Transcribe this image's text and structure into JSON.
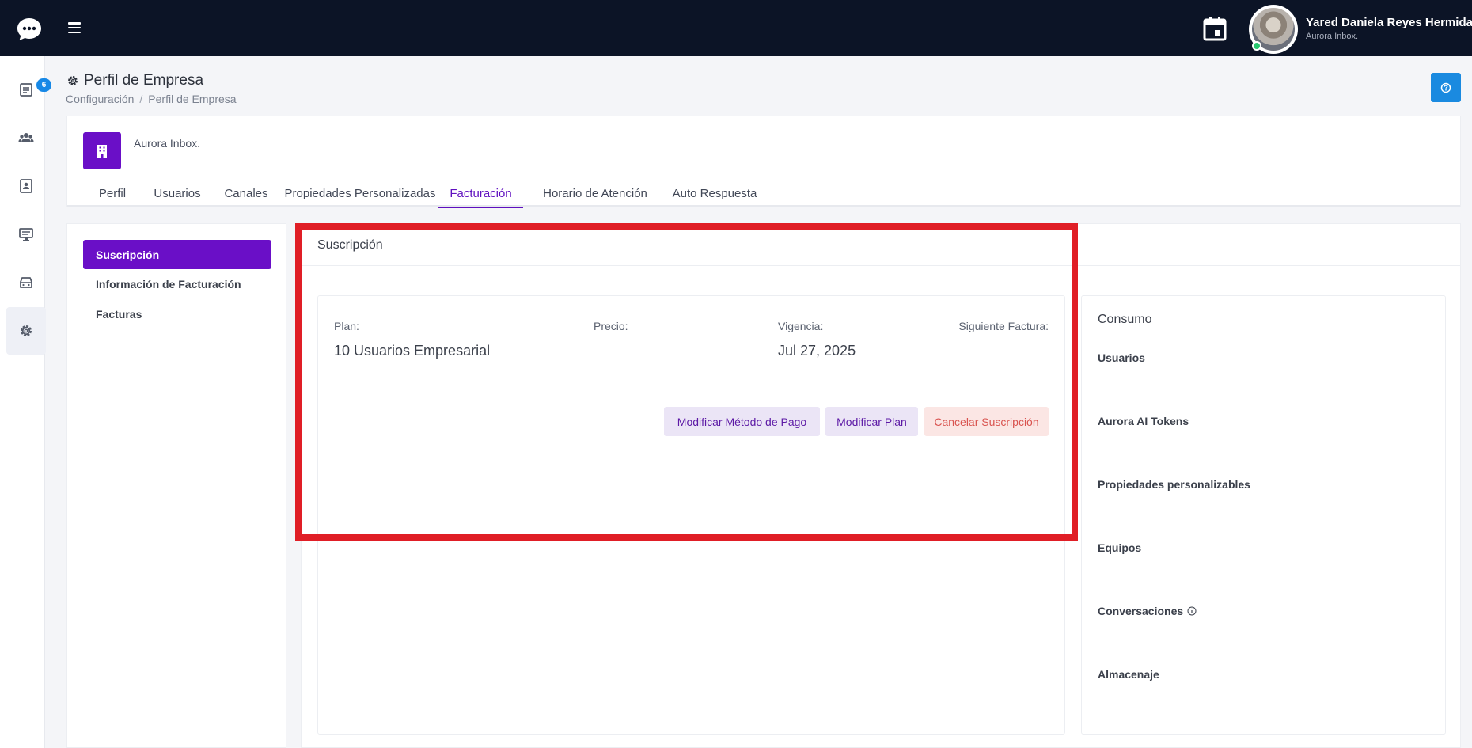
{
  "topbar": {
    "logo_icon": "chat-bubble-icon",
    "menu_icon": "hamburger-menu-icon",
    "calendar_icon": "calendar-icon",
    "user": {
      "name": "Yared Daniela Reyes Hermida",
      "organization": "Aurora Inbox.",
      "status": "online"
    }
  },
  "sidebar": {
    "items": [
      {
        "icon": "inbox-icon",
        "badge": "6"
      },
      {
        "icon": "team-icon"
      },
      {
        "icon": "contacts-icon"
      },
      {
        "icon": "monitor-icon"
      },
      {
        "icon": "tray-icon"
      },
      {
        "icon": "settings-icon",
        "active": true
      }
    ]
  },
  "header": {
    "title": "Perfil de Empresa",
    "title_icon": "gear-icon",
    "breadcrumb": [
      "Configuración",
      "Perfil de Empresa"
    ],
    "help_icon": "help-icon"
  },
  "company": {
    "name": "Aurora Inbox.",
    "icon": "building-icon",
    "tabs": [
      {
        "label": "Perfil"
      },
      {
        "label": "Usuarios"
      },
      {
        "label": "Canales"
      },
      {
        "label": "Propiedades Personalizadas"
      },
      {
        "label": "Facturación",
        "active": true
      },
      {
        "label": "Horario de Atención"
      },
      {
        "label": "Auto Respuesta"
      }
    ]
  },
  "subnav": {
    "items": [
      {
        "label": "Suscripción",
        "active": true
      },
      {
        "label": "Información de Facturación"
      },
      {
        "label": "Facturas"
      }
    ]
  },
  "subscription": {
    "header": "Suscripción",
    "plan_label": "Plan:",
    "plan_value": "10 Usuarios Empresarial",
    "price_label": "Precio:",
    "price_value": "",
    "validity_label": "Vigencia:",
    "validity_value": "Jul 27, 2025",
    "next_invoice_label": "Siguiente Factura:",
    "next_invoice_value": "",
    "buttons": {
      "modify_payment": "Modificar Método de Pago",
      "modify_plan": "Modificar Plan",
      "cancel": "Cancelar Suscripción"
    }
  },
  "usage": {
    "title": "Consumo",
    "items": [
      {
        "label": "Usuarios"
      },
      {
        "label": "Aurora AI Tokens"
      },
      {
        "label": "Propiedades personalizables"
      },
      {
        "label": "Equipos"
      },
      {
        "label": "Conversaciones",
        "info_icon": "info-icon"
      },
      {
        "label": "Almacenaje"
      }
    ]
  },
  "colors": {
    "topbar": "#0c1426",
    "accent_purple": "#6a0fc7",
    "help_blue": "#1a8ae0",
    "highlight_red": "#e01e26",
    "cancel_red": "#d9534f"
  }
}
